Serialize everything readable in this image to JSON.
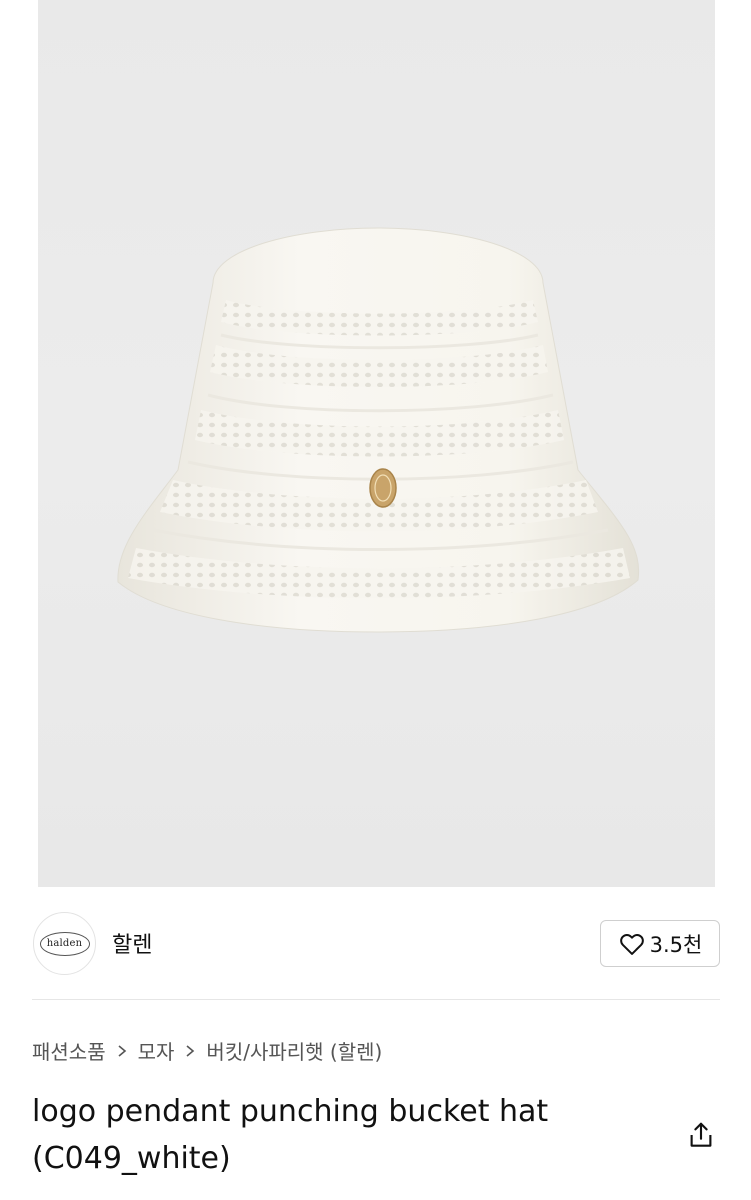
{
  "product_image": {
    "alt": ""
  },
  "brand": {
    "logo_text": "halden",
    "name": "할렌"
  },
  "like": {
    "count": "3.5천",
    "icon": "heart-outline-icon"
  },
  "breadcrumb": {
    "items": [
      "패션소품",
      "모자",
      "버킷/사파리햇 (할렌)"
    ],
    "separator_icon": "chevron-right-icon"
  },
  "product": {
    "title": "logo pendant punching bucket hat (C049_white)"
  },
  "share": {
    "icon": "share-icon"
  },
  "colors": {
    "background": "#ffffff",
    "photo_bg": "#eaeaea",
    "hat": "#f6f4ee",
    "pendant_gold": "#c9a46a"
  }
}
